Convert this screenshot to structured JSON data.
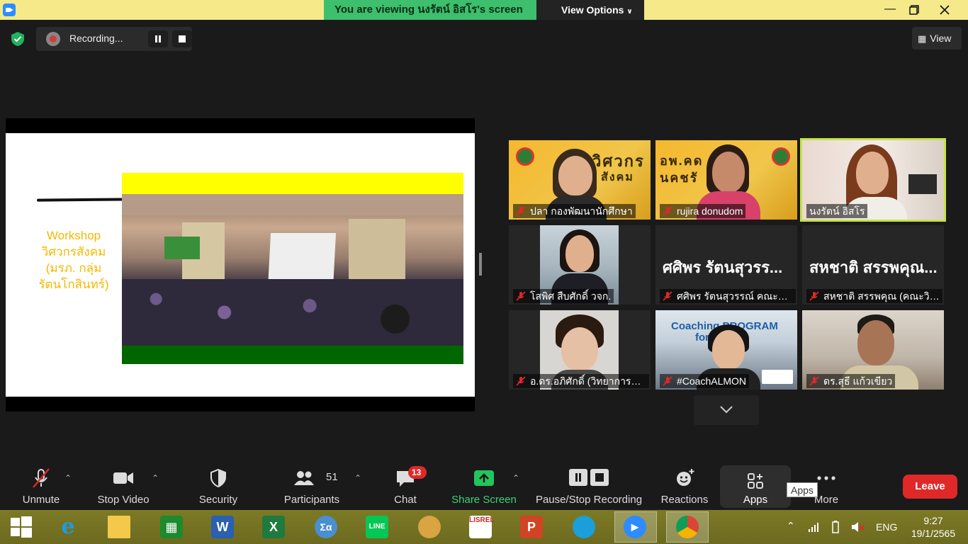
{
  "titlebar": {
    "viewing_text": "You are viewing นงรัตน์ อิสโร's screen",
    "view_options_label": "View Options"
  },
  "recording": {
    "label": "Recording..."
  },
  "view_button_label": "View",
  "slide": {
    "caption_line1": "Workshop",
    "caption_line2": "วิศวกรสังคม",
    "caption_line3": "(มรภ. กลุ่ม",
    "caption_line4": "รัตนโกสินทร์)"
  },
  "participants": [
    {
      "name": "ปลา กองพัฒนานักศึกษา"
    },
    {
      "name": "rujira donudom"
    },
    {
      "name": "นงรัตน์ อิสโร"
    },
    {
      "name": "โสพิศ สืบศักดิ์ วจก."
    },
    {
      "name": "ศศิพร รัตนสุวรรณ์ คณะวิท...",
      "big_name": "ศศิพร รัตนสุวรร..."
    },
    {
      "name": "สหชาติ สรรพคุณ (คณะวิท...",
      "big_name": "สหชาติ สรรพคุณ..."
    },
    {
      "name": "อ.ดร.อภิศักดิ์ (วิทยาการจัด..."
    },
    {
      "name": "#CoachALMON",
      "poster_text1": "Coaching PROGRAM",
      "poster_text2": "for"
    },
    {
      "name": "ดร.สุธี แก้วเขียว"
    }
  ],
  "poster": {
    "title1": "วิศวกร",
    "title2": "สังคม",
    "title3": "อพ.คด",
    "title4": "นคชรั"
  },
  "toolbar": {
    "unmute": "Unmute",
    "stop_video": "Stop Video",
    "security": "Security",
    "participants": "Participants",
    "participants_count": "51",
    "chat": "Chat",
    "chat_badge": "13",
    "share_screen": "Share Screen",
    "pause_stop_recording": "Pause/Stop Recording",
    "reactions": "Reactions",
    "apps": "Apps",
    "apps_tooltip": "Apps",
    "more": "More",
    "leave": "Leave"
  },
  "taskbar": {
    "language": "ENG",
    "time": "9:27",
    "date": "19/1/2565"
  },
  "colors": {
    "banner_green": "#3dbf6d",
    "titlebar_yellow": "#f5e989",
    "leave_red": "#e02828",
    "share_green": "#22c55e",
    "active_speaker": "#c6e24a"
  }
}
